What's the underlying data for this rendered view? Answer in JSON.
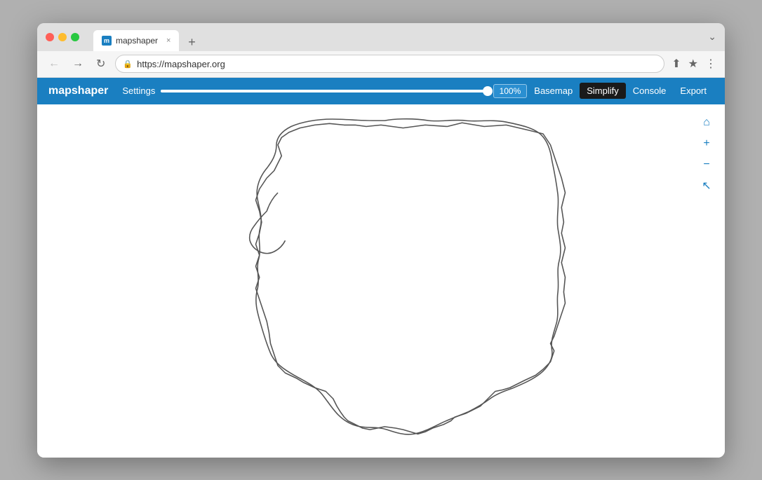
{
  "browser": {
    "tab_favicon": "m",
    "tab_title": "mapshaper",
    "tab_close": "×",
    "new_tab": "+",
    "window_chevron": "⌄",
    "nav_back": "←",
    "nav_forward": "→",
    "nav_refresh": "↻",
    "url": "https://mapshaper.org",
    "share_icon": "⬆",
    "bookmark_icon": "★",
    "more_icon": "⋮"
  },
  "toolbar": {
    "logo": "mapshaper",
    "settings_label": "Settings",
    "slider_percent": "100%",
    "basemap_label": "Basemap",
    "simplify_label": "Simplify",
    "console_label": "Console",
    "export_label": "Export"
  },
  "map_controls": {
    "home_icon": "⌂",
    "zoom_in_icon": "+",
    "zoom_out_icon": "−",
    "pointer_icon": "↖"
  }
}
